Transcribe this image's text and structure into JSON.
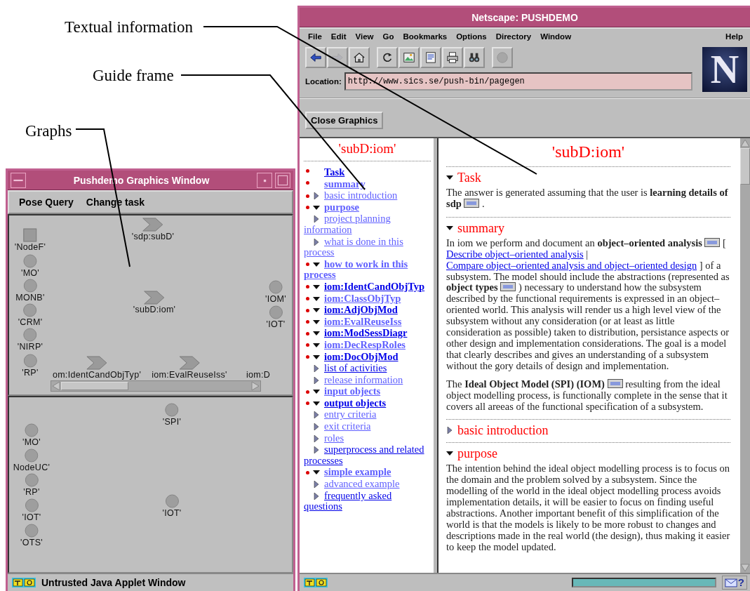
{
  "annotations": [
    {
      "text": "Textual information"
    },
    {
      "text": "Guide frame"
    },
    {
      "text": "Graphs"
    }
  ],
  "graphics_window": {
    "title": "Pushdemo Graphics Window",
    "menu": [
      "Pose Query",
      "Change task"
    ],
    "graphs": [
      {
        "nodes": [
          {
            "kind": "square",
            "label": "'NodeF'"
          },
          {
            "kind": "circle",
            "label": "'MO'"
          },
          {
            "kind": "circle",
            "label": "MONB'"
          },
          {
            "kind": "circle",
            "label": "'CRM'"
          },
          {
            "kind": "circle",
            "label": "'NIRP'"
          },
          {
            "kind": "circle",
            "label": "'RP'"
          },
          {
            "kind": "chevron",
            "label": "'sdp:subD'"
          },
          {
            "kind": "chevron",
            "label": "'subD:iom'"
          },
          {
            "kind": "circle",
            "label": "'IOM'"
          },
          {
            "kind": "circle",
            "label": "'IOT'"
          },
          {
            "kind": "chevron",
            "label": "om:IdentCandObjTyp'"
          },
          {
            "kind": "chevron",
            "label": "iom:EvalReuseIss'"
          },
          {
            "kind": "text",
            "label": "iom:D"
          }
        ]
      },
      {
        "nodes": [
          {
            "kind": "circle",
            "label": "'SPI'"
          },
          {
            "kind": "circle",
            "label": "'MO'"
          },
          {
            "kind": "circle",
            "label": "NodeUC'"
          },
          {
            "kind": "circle",
            "label": "'RP'"
          },
          {
            "kind": "circle",
            "label": "'IOT'"
          },
          {
            "kind": "circle",
            "label": "'IOT'"
          },
          {
            "kind": "circle",
            "label": "'OTS'"
          }
        ]
      }
    ],
    "status": "Untrusted Java Applet Window"
  },
  "browser": {
    "title": "Netscape: PUSHDEMO",
    "menu": [
      "File",
      "Edit",
      "View",
      "Go",
      "Bookmarks",
      "Options",
      "Directory",
      "Window"
    ],
    "help_menu": "Help",
    "toolbar": [
      [
        {
          "kind": "back",
          "disabled": false
        },
        {
          "kind": "forward",
          "disabled": true
        },
        {
          "kind": "home",
          "disabled": false
        }
      ],
      [
        {
          "kind": "reload",
          "disabled": false
        },
        {
          "kind": "images",
          "disabled": false
        },
        {
          "kind": "open",
          "disabled": false
        },
        {
          "kind": "print",
          "disabled": false
        },
        {
          "kind": "find",
          "disabled": false
        }
      ],
      [
        {
          "kind": "stop",
          "disabled": true
        }
      ]
    ],
    "logo": "N",
    "location": {
      "label": "Location:",
      "value": "http://www.sics.se/push-bin/pagegen"
    },
    "close_graphics_button": "Close Graphics",
    "guide": {
      "title": "'subD:iom'",
      "items": [
        {
          "label": "Task",
          "bold": true,
          "visited": false
        },
        {
          "label": "summary",
          "bold": true,
          "visited": true
        },
        {
          "label": "basic introduction",
          "bold": false,
          "visited": true,
          "expanded": false
        },
        {
          "label": "purpose",
          "bold": true,
          "visited": true,
          "expanded": true,
          "children": [
            {
              "label": "project planning information",
              "bold": false,
              "visited": true,
              "expanded": false
            },
            {
              "label": "what is done in this process",
              "bold": false,
              "visited": true,
              "expanded": false
            }
          ]
        },
        {
          "label": "how to work in this process",
          "bold": true,
          "visited": true,
          "expanded": true
        },
        {
          "label": "iom:IdentCandObjTyp",
          "bold": true,
          "visited": false,
          "expanded": true
        },
        {
          "label": "iom:ClassObjTyp",
          "bold": true,
          "visited": true,
          "expanded": true
        },
        {
          "label": "iom:AdjObjMod",
          "bold": true,
          "visited": false,
          "expanded": true
        },
        {
          "label": "iom:EvalReuseIss",
          "bold": true,
          "visited": true,
          "expanded": true
        },
        {
          "label": "iom:ModSessDiagr",
          "bold": true,
          "visited": false,
          "expanded": true
        },
        {
          "label": "iom:DecRespRoles",
          "bold": true,
          "visited": true,
          "expanded": true
        },
        {
          "label": "iom:DocObjMod",
          "bold": true,
          "visited": false,
          "expanded": true,
          "children": [
            {
              "label": "list of activities",
              "bold": false,
              "visited": false,
              "expanded": false
            },
            {
              "label": "release information",
              "bold": false,
              "visited": true,
              "expanded": false
            }
          ]
        },
        {
          "label": "input objects",
          "bold": true,
          "visited": true,
          "expanded": true
        },
        {
          "label": "output objects",
          "bold": true,
          "visited": false,
          "expanded": true,
          "children": [
            {
              "label": "entry criteria",
              "bold": false,
              "visited": true,
              "expanded": false
            },
            {
              "label": "exit criteria",
              "bold": false,
              "visited": true,
              "expanded": false
            },
            {
              "label": "roles",
              "bold": false,
              "visited": true,
              "expanded": false
            },
            {
              "label": "superprocess and related processes",
              "bold": false,
              "visited": false,
              "expanded": false
            }
          ]
        },
        {
          "label": "simple example",
          "bold": true,
          "visited": true,
          "expanded": true,
          "children": [
            {
              "label": "advanced example",
              "bold": false,
              "visited": true,
              "expanded": false
            },
            {
              "label": "frequently asked questions",
              "bold": false,
              "visited": false,
              "expanded": false
            }
          ]
        }
      ]
    },
    "content": {
      "title": "'subD:iom'",
      "sections": [
        {
          "heading": "Task",
          "expanded": true,
          "paragraphs": [
            [
              {
                "kind": "text",
                "text": "The answer is generated assuming that the user is **learning details of sdp** "
              },
              {
                "kind": "icon"
              },
              {
                "kind": "text",
                "text": " ."
              }
            ]
          ]
        },
        {
          "heading": "summary",
          "expanded": true,
          "paragraphs": [
            [
              {
                "kind": "text",
                "text": "In iom we perform and document an **object–oriented analysis** "
              },
              {
                "kind": "icon"
              },
              {
                "kind": "text",
                "text": " [ "
              },
              {
                "kind": "link",
                "text": "Describe object–oriented analysis"
              },
              {
                "kind": "text",
                "text": " | "
              },
              {
                "kind": "link",
                "text": "Compare object–oriented analysis and object–oriented design"
              },
              {
                "kind": "text",
                "text": " ] of a subsystem. The model should include the abstractions (represented as **object types** "
              },
              {
                "kind": "icon"
              },
              {
                "kind": "text",
                "text": " ) necessary to understand how the subsystem described by the functional requirements is expressed in an object–oriented world. This analysis will render us a high level view of the subsystem without any consideration (or at least as little consideration as possible) taken to distribution, persistance aspects or other design and implementation considerations. The goal is a model that clearly describes and gives an understanding of a subsystem without the gory details of design and implementation."
              }
            ],
            [
              {
                "kind": "text",
                "text": "The **Ideal Object Model (SPI) (IOM)** "
              },
              {
                "kind": "icon"
              },
              {
                "kind": "text",
                "text": " resulting from the ideal object modelling process, is functionally complete in the sense that it covers all areeas of the functional specification of a subsystem."
              }
            ]
          ]
        },
        {
          "heading": "basic introduction",
          "expanded": false
        },
        {
          "heading": "purpose",
          "expanded": true,
          "paragraphs": [
            [
              {
                "kind": "text",
                "text": "The intention behind the ideal object modelling process is to focus on the domain and the problem solved by a subsystem. Since the modelling of the world in the ideal object modelling process avoids implementation details, it will be easier to focus on finding useful abstractions. Another important benefit of this simplification of the world is that the models is likely to be more robust to changes and descriptions made in the real world (the design), thus making it easier to keep the model updated."
              }
            ]
          ]
        }
      ]
    },
    "status": {
      "help": "?"
    }
  }
}
